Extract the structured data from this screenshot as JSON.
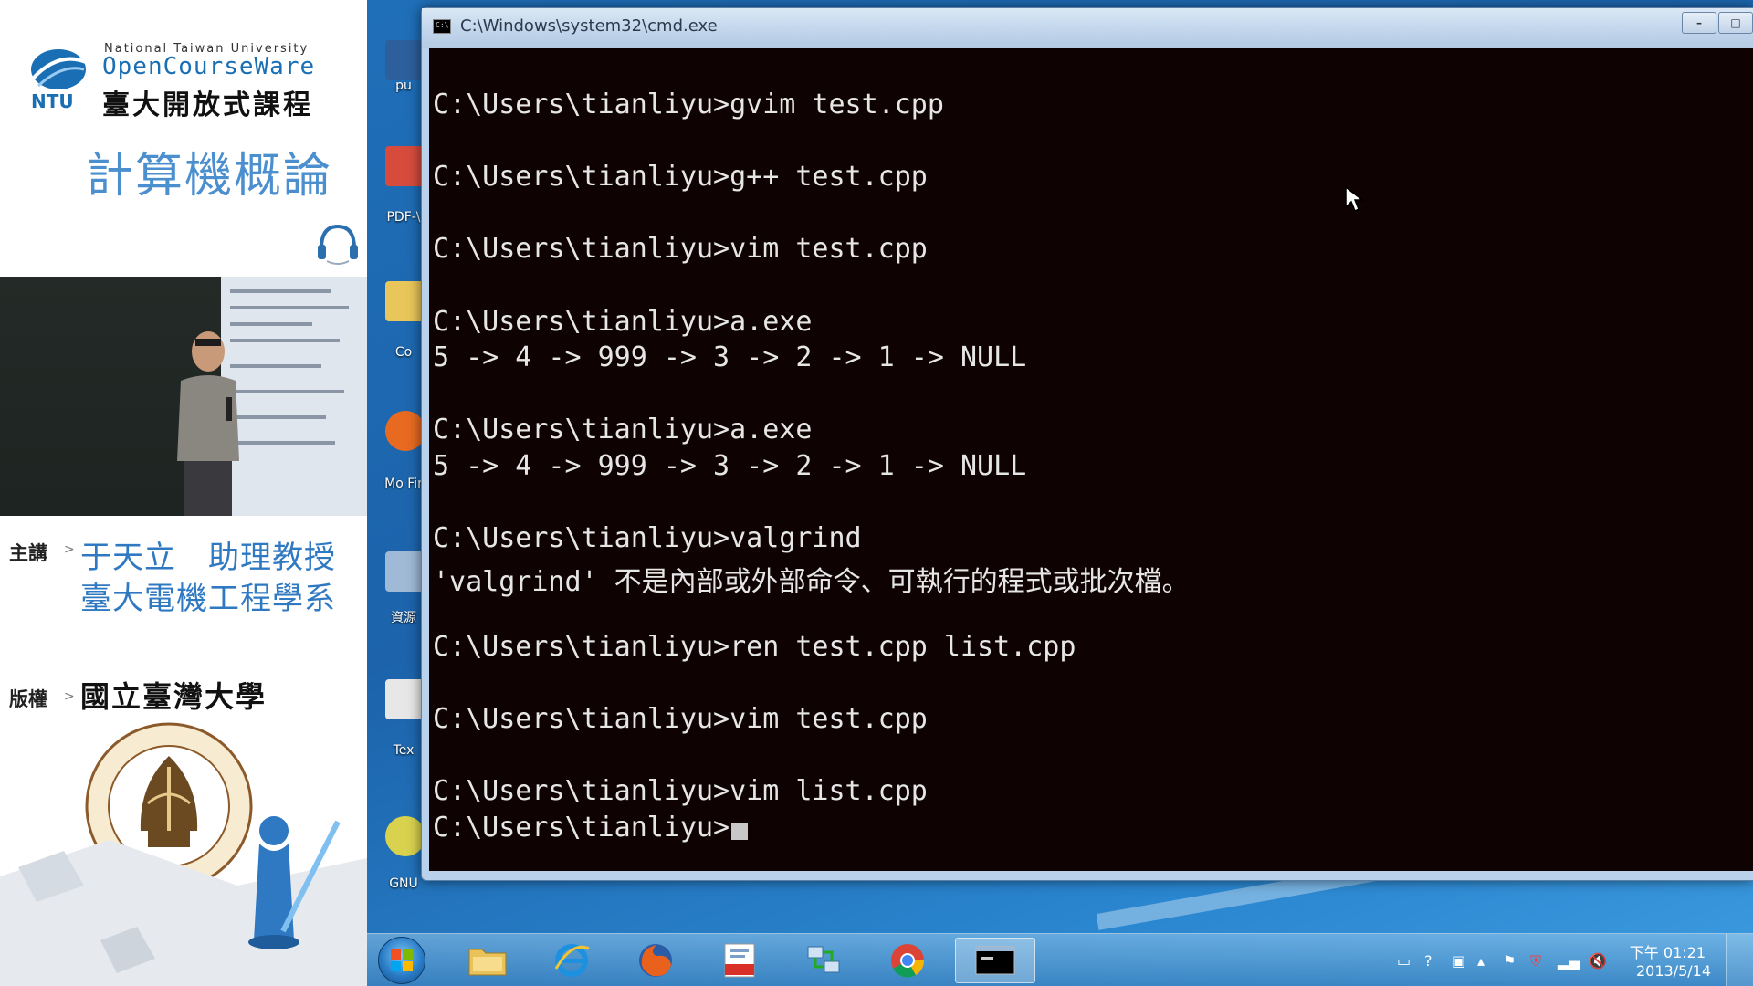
{
  "sidebar": {
    "logo": {
      "ntu_en": "National Taiwan University",
      "ocw": "OpenCourseWare",
      "ocw_zh": "臺大開放式課程",
      "mark_text": "NTU"
    },
    "course_title": "計算機概論",
    "instructor": {
      "label": "主講",
      "arrow": ">",
      "name": "于天立　助理教授",
      "department": "臺大電機工程學系"
    },
    "copyright": {
      "label": "版權",
      "arrow": ">",
      "owner": "國立臺灣大學"
    },
    "seal_text": "國立臺灣大學"
  },
  "desktop": {
    "icons": [
      {
        "label": "pu",
        "color": "#2d5f9c"
      },
      {
        "label": "PDF-\\",
        "color": "#d64b3c"
      },
      {
        "label": "Co",
        "color": "#e8c65a"
      },
      {
        "label": "Mo Fir",
        "color": "#e86a21"
      },
      {
        "label": "資源",
        "color": "#9fb9d6"
      },
      {
        "label": "Tex",
        "color": "#e7e7e7"
      },
      {
        "label": "GNU",
        "color": "#d8d24e"
      }
    ]
  },
  "cmd": {
    "title": "C:\\Windows\\system32\\cmd.exe",
    "icon_text": "C:\\",
    "buttons": {
      "minimize": "–",
      "maximize": "□"
    },
    "lines": [
      "",
      "C:\\Users\\tianliyu>gvim test.cpp",
      "",
      "C:\\Users\\tianliyu>g++ test.cpp",
      "",
      "C:\\Users\\tianliyu>vim test.cpp",
      "",
      "C:\\Users\\tianliyu>a.exe",
      "5 -> 4 -> 999 -> 3 -> 2 -> 1 -> NULL",
      "",
      "C:\\Users\\tianliyu>a.exe",
      "5 -> 4 -> 999 -> 3 -> 2 -> 1 -> NULL",
      "",
      "C:\\Users\\tianliyu>valgrind",
      "'valgrind' 不是內部或外部命令、可執行的程式或批次檔。",
      "",
      "C:\\Users\\tianliyu>ren test.cpp list.cpp",
      "",
      "C:\\Users\\tianliyu>vim test.cpp",
      "",
      "C:\\Users\\tianliyu>vim list.cpp",
      ""
    ],
    "prompt": "C:\\Users\\tianliyu>"
  },
  "taskbar": {
    "items": [
      {
        "name": "explorer",
        "icon": "folder-icon"
      },
      {
        "name": "ie",
        "icon": "internet-explorer-icon"
      },
      {
        "name": "firefox",
        "icon": "firefox-icon"
      },
      {
        "name": "pdf",
        "icon": "pdf-icon"
      },
      {
        "name": "network",
        "icon": "network-icon"
      },
      {
        "name": "chrome",
        "icon": "chrome-icon"
      },
      {
        "name": "cmd",
        "icon": "cmd-icon",
        "active": true
      }
    ],
    "clock": {
      "time": "下午 01:21",
      "date": "2013/5/14"
    }
  }
}
